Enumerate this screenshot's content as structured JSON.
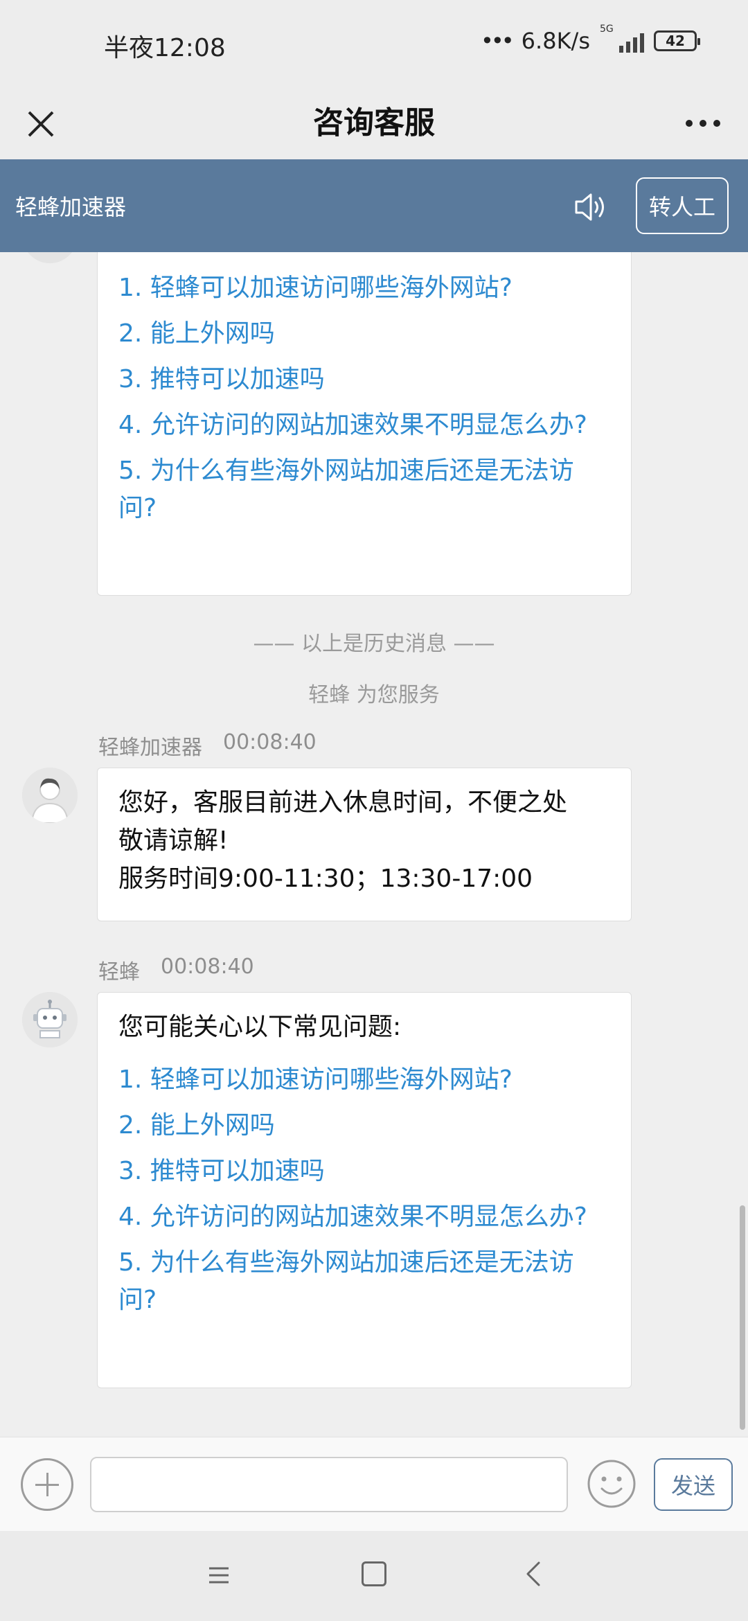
{
  "status_bar": {
    "time": "半夜12:08",
    "net_speed": "6.8K/s",
    "network_type": "5G",
    "battery": "42"
  },
  "title_bar": {
    "title": "咨询客服",
    "close_icon": "close-icon",
    "more_icon": "more-icon"
  },
  "service_header": {
    "name": "轻蜂加速器",
    "speaker_icon": "speaker-icon",
    "human_button": "转人工",
    "background": "#5a7a9c"
  },
  "chat": {
    "history_faq": [
      "1. 轻蜂可以加速访问哪些海外网站?",
      "2. 能上外网吗",
      "3. 推特可以加速吗",
      "4. 允许访问的网站加速效果不明显怎么办?",
      "5. 为什么有些海外网站加速后还是无法访问?"
    ],
    "history_divider": "—— 以上是历史消息 ——",
    "service_notice": "轻蜂 为您服务",
    "messages": [
      {
        "sender": "轻蜂加速器",
        "time": "00:08:40",
        "avatar": "person-avatar",
        "lines": [
          "您好，客服目前进入休息时间，不便之处",
          "敬请谅解!",
          "服务时间9:00-11:30；13:30-17:00"
        ]
      },
      {
        "sender": "轻蜂",
        "time": "00:08:40",
        "avatar": "robot-avatar",
        "intro": "您可能关心以下常见问题:",
        "faq": [
          "1. 轻蜂可以加速访问哪些海外网站?",
          "2. 能上外网吗",
          "3. 推特可以加速吗",
          "4. 允许访问的网站加速效果不明显怎么办?",
          "5. 为什么有些海外网站加速后还是无法访问?"
        ]
      }
    ]
  },
  "input_bar": {
    "placeholder": "",
    "value": "",
    "send_label": "发送"
  },
  "colors": {
    "link": "#2d8ad0",
    "accent": "#5a7a9c"
  }
}
